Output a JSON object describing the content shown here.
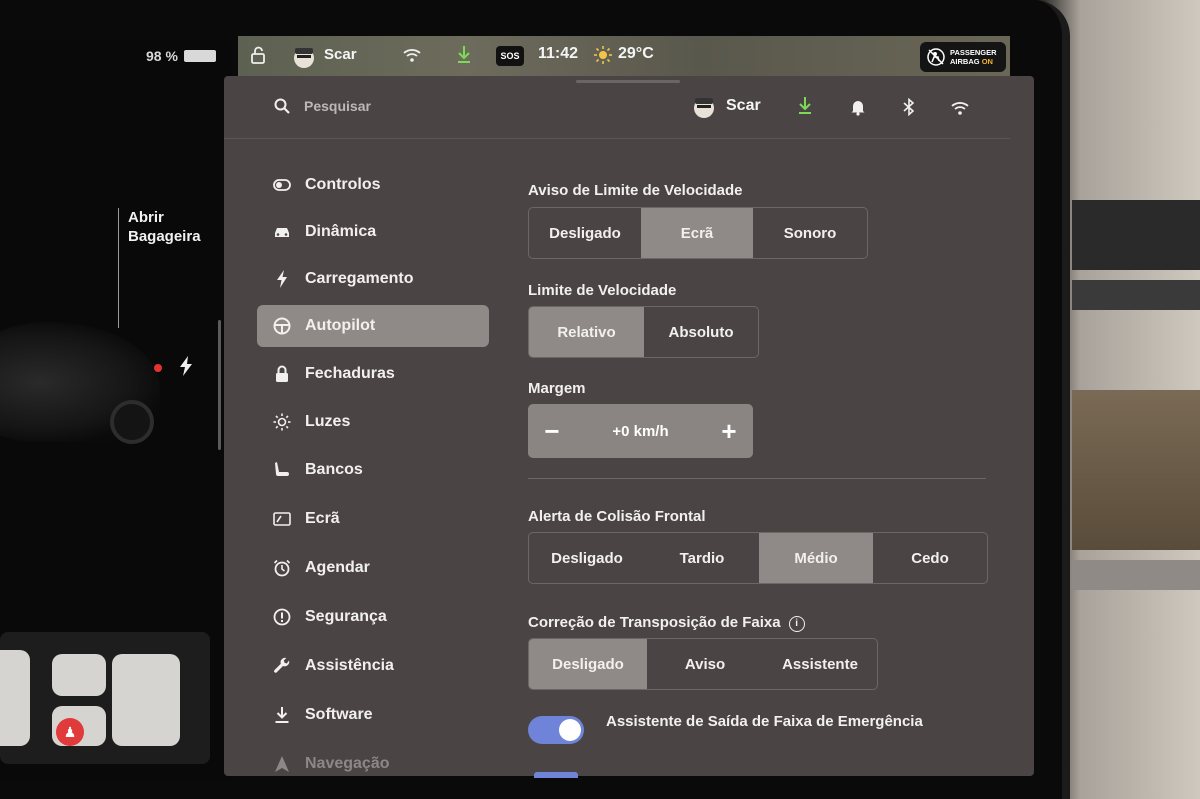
{
  "vehicle": {
    "battery": "98 %",
    "trunk_label": "Abrir\nBagageira"
  },
  "status_bar": {
    "user": "Scar",
    "sos": "SOS",
    "time": "11:42",
    "temperature": "29°C",
    "airbag_line1": "PASSENGER",
    "airbag_line2": "AIRBAG",
    "airbag_state": "ON",
    "airbag_state_color": "#f0b428"
  },
  "header": {
    "search_placeholder": "Pesquisar",
    "user": "Scar",
    "download_color": "#7ed957"
  },
  "menu": {
    "items": [
      {
        "label": "Controlos",
        "icon": "toggle-icon"
      },
      {
        "label": "Dinâmica",
        "icon": "car-icon"
      },
      {
        "label": "Carregamento",
        "icon": "bolt-icon"
      },
      {
        "label": "Autopilot",
        "icon": "steering-wheel-icon",
        "active": true
      },
      {
        "label": "Fechaduras",
        "icon": "lock-icon"
      },
      {
        "label": "Luzes",
        "icon": "sun-icon"
      },
      {
        "label": "Bancos",
        "icon": "seat-icon"
      },
      {
        "label": "Ecrã",
        "icon": "display-icon"
      },
      {
        "label": "Agendar",
        "icon": "alarm-clock-icon"
      },
      {
        "label": "Segurança",
        "icon": "alert-circle-icon"
      },
      {
        "label": "Assistência",
        "icon": "wrench-icon"
      },
      {
        "label": "Software",
        "icon": "download-icon"
      },
      {
        "label": "Navegação",
        "icon": "navigation-icon"
      }
    ]
  },
  "settings": {
    "speed_limit_warning": {
      "label": "Aviso de Limite de Velocidade",
      "options": [
        "Desligado",
        "Ecrã",
        "Sonoro"
      ],
      "selected": "Ecrã"
    },
    "speed_limit": {
      "label": "Limite de Velocidade",
      "options": [
        "Relativo",
        "Absoluto"
      ],
      "selected": "Relativo"
    },
    "margin": {
      "label": "Margem",
      "minus": "−",
      "value": "+0 km/h",
      "plus": "+"
    },
    "forward_collision": {
      "label": "Alerta de Colisão Frontal",
      "options": [
        "Desligado",
        "Tardio",
        "Médio",
        "Cedo"
      ],
      "selected": "Médio"
    },
    "lane_departure": {
      "label": "Correção de Transposição de Faixa",
      "info": "i",
      "options": [
        "Desligado",
        "Aviso",
        "Assistente"
      ],
      "selected": "Desligado"
    },
    "emergency_lane_departure": {
      "label": "Assistente de Saída de Faixa de Emergência",
      "enabled": true,
      "toggle_color": "#6f84d8"
    }
  },
  "colors": {
    "panel": "#4a4544",
    "selected": "#8f8987"
  }
}
